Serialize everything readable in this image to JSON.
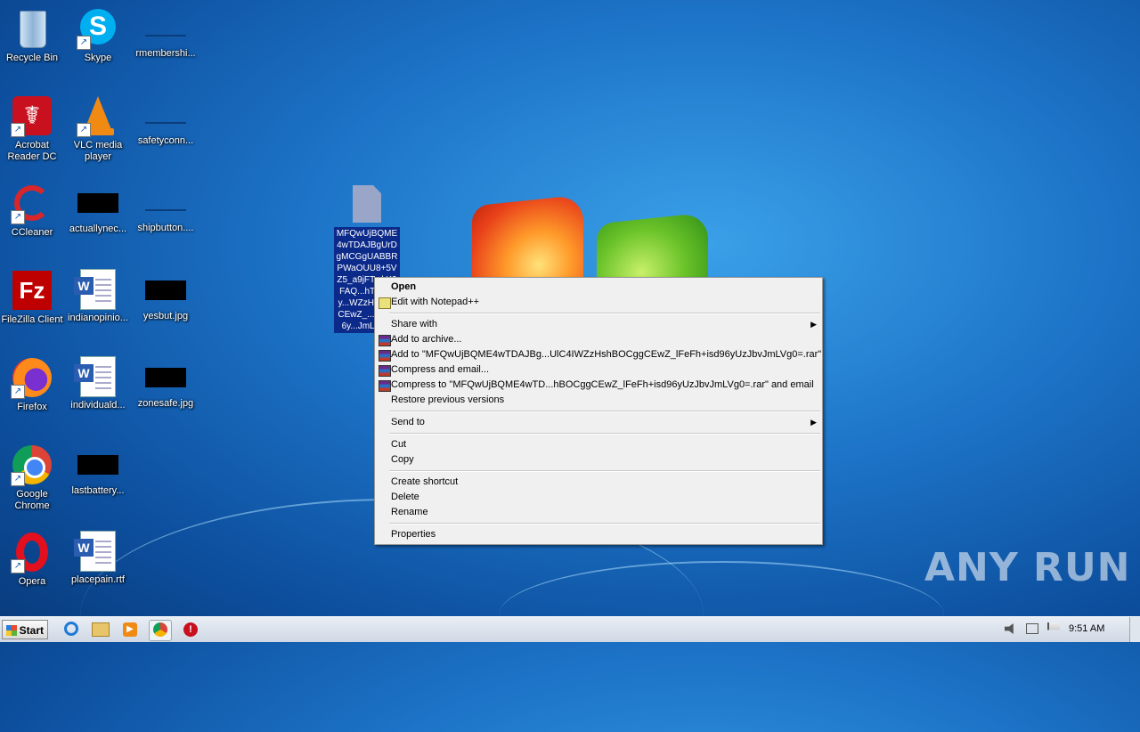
{
  "desktop": {
    "icons": [
      {
        "id": "recycle-bin",
        "label": "Recycle Bin"
      },
      {
        "id": "skype",
        "label": "Skype"
      },
      {
        "id": "rmembership",
        "label": "rmembershi..."
      },
      {
        "id": "acrobat",
        "label": "Acrobat Reader DC"
      },
      {
        "id": "vlc",
        "label": "VLC media player"
      },
      {
        "id": "safetyconn",
        "label": "safetyconn..."
      },
      {
        "id": "ccleaner",
        "label": "CCleaner"
      },
      {
        "id": "actuallynec",
        "label": "actuallynec..."
      },
      {
        "id": "shipbutton",
        "label": "shipbutton...."
      },
      {
        "id": "filezilla",
        "label": "FileZilla Client"
      },
      {
        "id": "indianopinio",
        "label": "indianopinio..."
      },
      {
        "id": "yesbut",
        "label": "yesbut.jpg"
      },
      {
        "id": "firefox",
        "label": "Firefox"
      },
      {
        "id": "individuald",
        "label": "individuald..."
      },
      {
        "id": "zonesafe",
        "label": "zonesafe.jpg"
      },
      {
        "id": "chrome",
        "label": "Google Chrome"
      },
      {
        "id": "lastbattery",
        "label": "lastbattery..."
      },
      {
        "id": "opera",
        "label": "Opera"
      },
      {
        "id": "placepain",
        "label": "placepain.rtf"
      }
    ],
    "selected_file": {
      "name": "MFQwUjBQME4wTDAJBgUrDgMCGgUABBRPWaOUU8+5VZ5_a9jFT...kK3FAQ...hTTsvAy...WZzHsh...gCEwZ_...+isd96y...JmLVg..."
    }
  },
  "context_menu": {
    "open": "Open",
    "edit_npp": "Edit with Notepad++",
    "share_with": "Share with",
    "add_archive": "Add to archive...",
    "add_to_rar": "Add to \"MFQwUjBQME4wTDAJBg...UlC4IWZzHshBOCggCEwZ_lFeFh+isd96yUzJbvJmLVg0=.rar\"",
    "compress_email": "Compress and email...",
    "compress_to_rar_email": "Compress to \"MFQwUjBQME4wTD...hBOCggCEwZ_lFeFh+isd96yUzJbvJmLVg0=.rar\" and email",
    "restore_prev": "Restore previous versions",
    "send_to": "Send to",
    "cut": "Cut",
    "copy": "Copy",
    "create_shortcut": "Create shortcut",
    "delete": "Delete",
    "rename": "Rename",
    "properties": "Properties"
  },
  "watermark": "ANY RUN",
  "taskbar": {
    "start_label": "Start",
    "pinned": [
      "internet-explorer-icon",
      "file-explorer-icon",
      "media-player-icon",
      "chrome-icon",
      "opera-icon"
    ],
    "clock": "9:51 AM"
  },
  "colors": {
    "selection": "#0b2a8a",
    "menu_bg": "#f0f0f0",
    "taskbar": "#dde4ed"
  }
}
